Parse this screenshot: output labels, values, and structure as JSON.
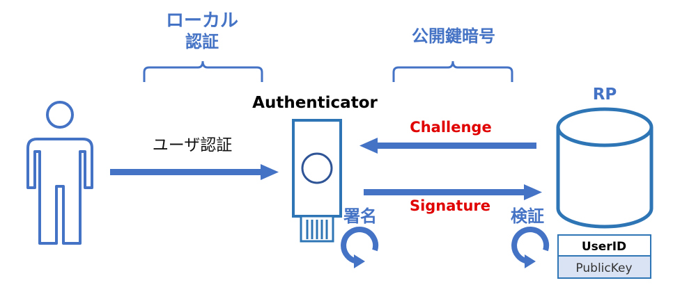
{
  "labels": {
    "local_auth_line1": "ローカル",
    "local_auth_line2": "認証",
    "public_key_crypto": "公開鍵暗号",
    "authenticator": "Authenticator",
    "rp": "RP",
    "user_auth": "ユーザ認証",
    "challenge": "Challenge",
    "signature": "Signature",
    "sign": "署名",
    "verify": "検証"
  },
  "rp_table": {
    "row1": "UserID",
    "row2": "PublicKey"
  },
  "colors": {
    "accent_blue": "#4472C4",
    "dark_blue": "#2F5597",
    "red": "#E00000",
    "table_row2_fill": "#DAE3F3"
  },
  "icons": {
    "user": "person-icon",
    "authenticator": "security-key-icon",
    "rp": "database-cylinder-icon",
    "sign_cycle": "circular-arrow-icon",
    "verify_cycle": "circular-arrow-icon"
  }
}
